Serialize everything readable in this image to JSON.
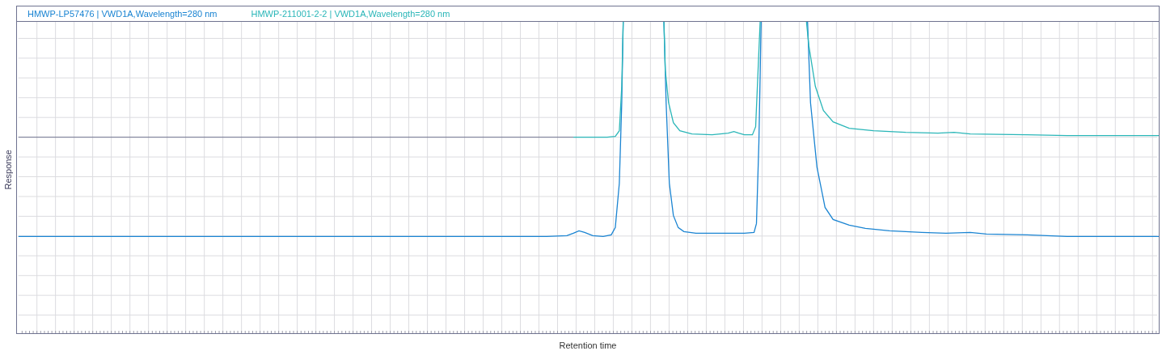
{
  "legend": [
    {
      "label": "HMWP-LP57476 | VWD1A,Wavelength=280 nm",
      "color": "#1a84d2"
    },
    {
      "label": "HMWP-211001-2-2 | VWD1A,Wavelength=280 nm",
      "color": "#2ab6b8"
    }
  ],
  "y_axis": {
    "label": "Response"
  },
  "x_axis": {
    "label": "Retention time"
  }
}
